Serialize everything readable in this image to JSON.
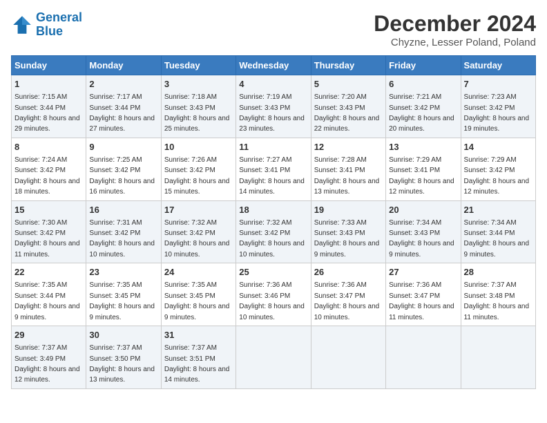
{
  "logo": {
    "line1": "General",
    "line2": "Blue"
  },
  "title": "December 2024",
  "subtitle": "Chyzne, Lesser Poland, Poland",
  "days_header": [
    "Sunday",
    "Monday",
    "Tuesday",
    "Wednesday",
    "Thursday",
    "Friday",
    "Saturday"
  ],
  "weeks": [
    [
      {
        "day": "1",
        "sunrise": "Sunrise: 7:15 AM",
        "sunset": "Sunset: 3:44 PM",
        "daylight": "Daylight: 8 hours and 29 minutes."
      },
      {
        "day": "2",
        "sunrise": "Sunrise: 7:17 AM",
        "sunset": "Sunset: 3:44 PM",
        "daylight": "Daylight: 8 hours and 27 minutes."
      },
      {
        "day": "3",
        "sunrise": "Sunrise: 7:18 AM",
        "sunset": "Sunset: 3:43 PM",
        "daylight": "Daylight: 8 hours and 25 minutes."
      },
      {
        "day": "4",
        "sunrise": "Sunrise: 7:19 AM",
        "sunset": "Sunset: 3:43 PM",
        "daylight": "Daylight: 8 hours and 23 minutes."
      },
      {
        "day": "5",
        "sunrise": "Sunrise: 7:20 AM",
        "sunset": "Sunset: 3:43 PM",
        "daylight": "Daylight: 8 hours and 22 minutes."
      },
      {
        "day": "6",
        "sunrise": "Sunrise: 7:21 AM",
        "sunset": "Sunset: 3:42 PM",
        "daylight": "Daylight: 8 hours and 20 minutes."
      },
      {
        "day": "7",
        "sunrise": "Sunrise: 7:23 AM",
        "sunset": "Sunset: 3:42 PM",
        "daylight": "Daylight: 8 hours and 19 minutes."
      }
    ],
    [
      {
        "day": "8",
        "sunrise": "Sunrise: 7:24 AM",
        "sunset": "Sunset: 3:42 PM",
        "daylight": "Daylight: 8 hours and 18 minutes."
      },
      {
        "day": "9",
        "sunrise": "Sunrise: 7:25 AM",
        "sunset": "Sunset: 3:42 PM",
        "daylight": "Daylight: 8 hours and 16 minutes."
      },
      {
        "day": "10",
        "sunrise": "Sunrise: 7:26 AM",
        "sunset": "Sunset: 3:42 PM",
        "daylight": "Daylight: 8 hours and 15 minutes."
      },
      {
        "day": "11",
        "sunrise": "Sunrise: 7:27 AM",
        "sunset": "Sunset: 3:41 PM",
        "daylight": "Daylight: 8 hours and 14 minutes."
      },
      {
        "day": "12",
        "sunrise": "Sunrise: 7:28 AM",
        "sunset": "Sunset: 3:41 PM",
        "daylight": "Daylight: 8 hours and 13 minutes."
      },
      {
        "day": "13",
        "sunrise": "Sunrise: 7:29 AM",
        "sunset": "Sunset: 3:41 PM",
        "daylight": "Daylight: 8 hours and 12 minutes."
      },
      {
        "day": "14",
        "sunrise": "Sunrise: 7:29 AM",
        "sunset": "Sunset: 3:42 PM",
        "daylight": "Daylight: 8 hours and 12 minutes."
      }
    ],
    [
      {
        "day": "15",
        "sunrise": "Sunrise: 7:30 AM",
        "sunset": "Sunset: 3:42 PM",
        "daylight": "Daylight: 8 hours and 11 minutes."
      },
      {
        "day": "16",
        "sunrise": "Sunrise: 7:31 AM",
        "sunset": "Sunset: 3:42 PM",
        "daylight": "Daylight: 8 hours and 10 minutes."
      },
      {
        "day": "17",
        "sunrise": "Sunrise: 7:32 AM",
        "sunset": "Sunset: 3:42 PM",
        "daylight": "Daylight: 8 hours and 10 minutes."
      },
      {
        "day": "18",
        "sunrise": "Sunrise: 7:32 AM",
        "sunset": "Sunset: 3:42 PM",
        "daylight": "Daylight: 8 hours and 10 minutes."
      },
      {
        "day": "19",
        "sunrise": "Sunrise: 7:33 AM",
        "sunset": "Sunset: 3:43 PM",
        "daylight": "Daylight: 8 hours and 9 minutes."
      },
      {
        "day": "20",
        "sunrise": "Sunrise: 7:34 AM",
        "sunset": "Sunset: 3:43 PM",
        "daylight": "Daylight: 8 hours and 9 minutes."
      },
      {
        "day": "21",
        "sunrise": "Sunrise: 7:34 AM",
        "sunset": "Sunset: 3:44 PM",
        "daylight": "Daylight: 8 hours and 9 minutes."
      }
    ],
    [
      {
        "day": "22",
        "sunrise": "Sunrise: 7:35 AM",
        "sunset": "Sunset: 3:44 PM",
        "daylight": "Daylight: 8 hours and 9 minutes."
      },
      {
        "day": "23",
        "sunrise": "Sunrise: 7:35 AM",
        "sunset": "Sunset: 3:45 PM",
        "daylight": "Daylight: 8 hours and 9 minutes."
      },
      {
        "day": "24",
        "sunrise": "Sunrise: 7:35 AM",
        "sunset": "Sunset: 3:45 PM",
        "daylight": "Daylight: 8 hours and 9 minutes."
      },
      {
        "day": "25",
        "sunrise": "Sunrise: 7:36 AM",
        "sunset": "Sunset: 3:46 PM",
        "daylight": "Daylight: 8 hours and 10 minutes."
      },
      {
        "day": "26",
        "sunrise": "Sunrise: 7:36 AM",
        "sunset": "Sunset: 3:47 PM",
        "daylight": "Daylight: 8 hours and 10 minutes."
      },
      {
        "day": "27",
        "sunrise": "Sunrise: 7:36 AM",
        "sunset": "Sunset: 3:47 PM",
        "daylight": "Daylight: 8 hours and 11 minutes."
      },
      {
        "day": "28",
        "sunrise": "Sunrise: 7:37 AM",
        "sunset": "Sunset: 3:48 PM",
        "daylight": "Daylight: 8 hours and 11 minutes."
      }
    ],
    [
      {
        "day": "29",
        "sunrise": "Sunrise: 7:37 AM",
        "sunset": "Sunset: 3:49 PM",
        "daylight": "Daylight: 8 hours and 12 minutes."
      },
      {
        "day": "30",
        "sunrise": "Sunrise: 7:37 AM",
        "sunset": "Sunset: 3:50 PM",
        "daylight": "Daylight: 8 hours and 13 minutes."
      },
      {
        "day": "31",
        "sunrise": "Sunrise: 7:37 AM",
        "sunset": "Sunset: 3:51 PM",
        "daylight": "Daylight: 8 hours and 14 minutes."
      },
      null,
      null,
      null,
      null
    ]
  ]
}
